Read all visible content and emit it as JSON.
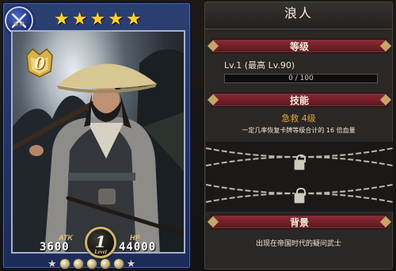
{
  "card": {
    "class_icon": "crossed-swords-icon",
    "rarity_stars": 5,
    "star_glyph": "★",
    "evolution": "0",
    "atk_label": "ATK",
    "atk_value": "3600",
    "hp_label": "HP",
    "hp_value": "44000",
    "level": "1",
    "level_word": "Level",
    "awakening_gems": 5,
    "colors": {
      "frame": "#1c2b58",
      "star": "#ffd22e",
      "gold": "#cfb56a"
    }
  },
  "panel": {
    "title": "浪人",
    "sections": {
      "level_header": "等级",
      "skill_header": "技能",
      "background_header": "背景"
    },
    "level_text": "Lv.1 (最高 Lv.90)",
    "exp_text": "0 / 100",
    "exp_progress": 0,
    "skill_name": "急救 4级",
    "skill_desc": "一定几率恢复卡牌等级合计的 16 倍血量",
    "background_text": "出现在帝国时代的疑问武士",
    "colors": {
      "ribbon": "#8c2a35",
      "skill_name": "#e3a63d"
    }
  }
}
